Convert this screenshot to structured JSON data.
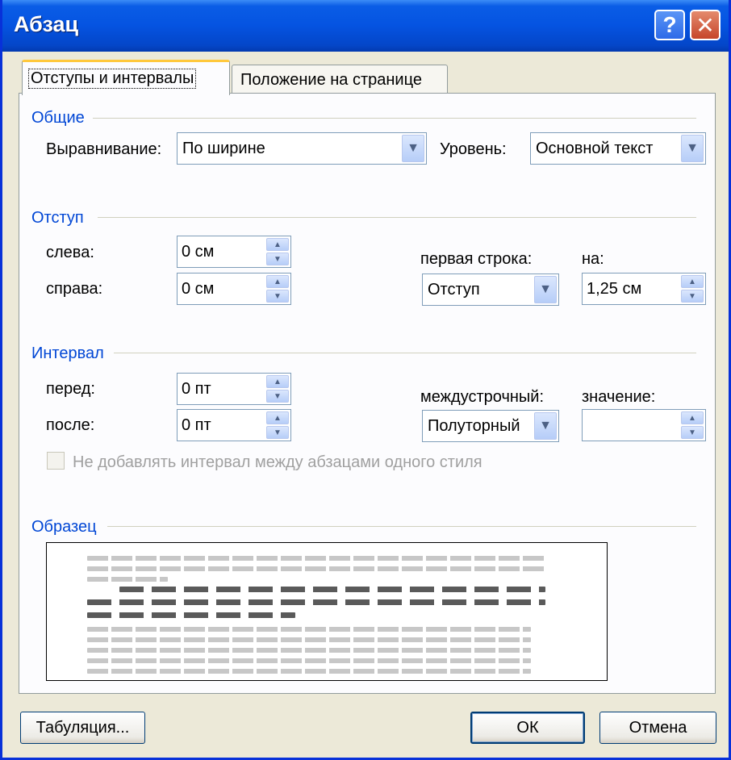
{
  "window": {
    "title": "Абзац"
  },
  "titlebar": {
    "help_glyph": "?",
    "close_glyph": "✕"
  },
  "tabs": [
    {
      "label": "Отступы и интервалы",
      "active": true
    },
    {
      "label": "Положение на странице",
      "active": false
    }
  ],
  "general": {
    "title": "Общие",
    "alignment_label": "Выравнивание:",
    "alignment_value": "По ширине",
    "level_label": "Уровень:",
    "level_value": "Основной текст"
  },
  "indent": {
    "title": "Отступ",
    "left_label": "слева:",
    "left_value": "0 см",
    "right_label": "справа:",
    "right_value": "0 см",
    "first_line_label": "первая строка:",
    "first_line_value": "Отступ",
    "by_label": "на:",
    "by_value": "1,25 см"
  },
  "spacing": {
    "title": "Интервал",
    "before_label": "перед:",
    "before_value": "0 пт",
    "after_label": "после:",
    "after_value": "0 пт",
    "line_spacing_label": "междустрочный:",
    "line_spacing_value": "Полуторный",
    "value_label": "значение:",
    "value_value": "",
    "no_space_checkbox_label": "Не добавлять интервал между абзацами одного стиля",
    "no_space_checked": false
  },
  "preview": {
    "title": "Образец"
  },
  "buttons": {
    "tabs_label": "Табуляция...",
    "ok_label": "ОК",
    "cancel_label": "Отмена"
  },
  "icons": {
    "dropdown": "chevron-down-icon",
    "spin_up": "triangle-up-icon",
    "spin_down": "triangle-down-icon"
  },
  "colors": {
    "title_bar": "#0553e1",
    "group_title": "#0046d5",
    "dialog_bg": "#ece9d8",
    "tab_highlight": "#ffc83c"
  }
}
